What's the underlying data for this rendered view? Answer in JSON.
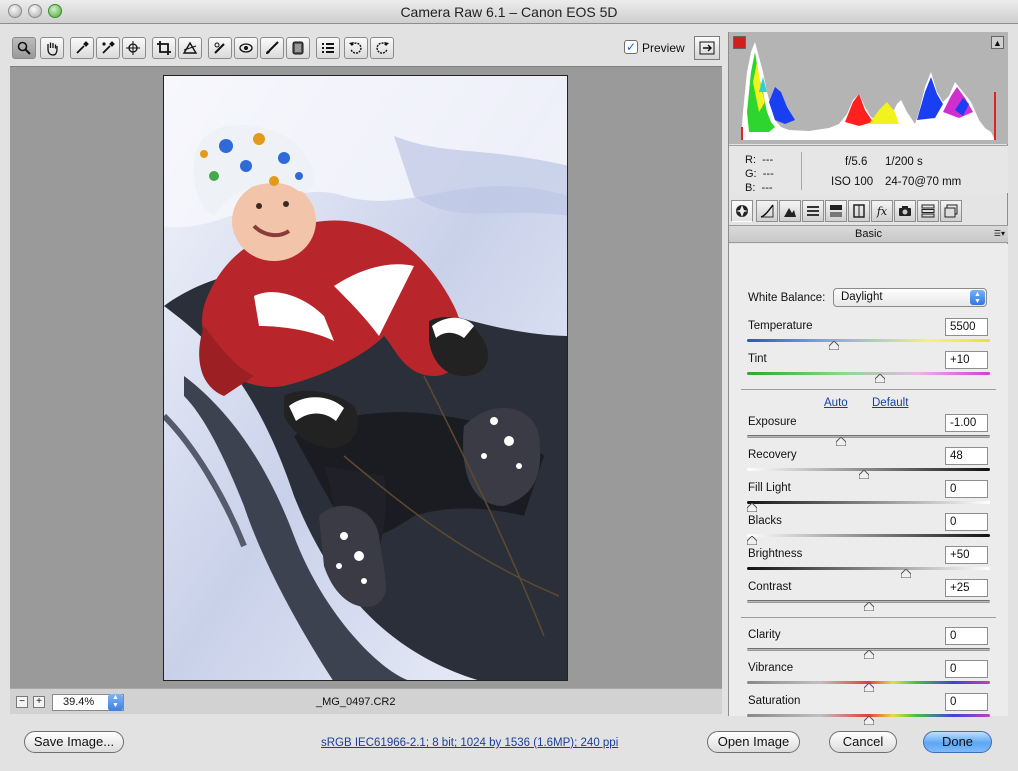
{
  "window": {
    "title": "Camera Raw 6.1  –  Canon EOS 5D"
  },
  "toolbar": {
    "tools": [
      {
        "name": "zoom-tool",
        "icon": "magnifier-icon"
      },
      {
        "name": "hand-tool",
        "icon": "hand-icon"
      },
      {
        "name": "white-balance-tool",
        "icon": "eyedropper-icon"
      },
      {
        "name": "color-sampler-tool",
        "icon": "color-sampler-icon"
      },
      {
        "name": "targeted-adjustment-tool",
        "icon": "target-icon"
      },
      {
        "name": "crop-tool",
        "icon": "crop-icon"
      },
      {
        "name": "straighten-tool",
        "icon": "straighten-icon"
      },
      {
        "name": "spot-removal-tool",
        "icon": "spot-brush-icon"
      },
      {
        "name": "red-eye-tool",
        "icon": "red-eye-icon"
      },
      {
        "name": "adjustment-brush-tool",
        "icon": "brush-icon"
      },
      {
        "name": "graduated-filter-tool",
        "icon": "gradient-icon"
      },
      {
        "name": "preferences-tool",
        "icon": "list-icon"
      },
      {
        "name": "rotate-ccw-tool",
        "icon": "rotate-ccw-icon"
      },
      {
        "name": "rotate-cw-tool",
        "icon": "rotate-cw-icon"
      }
    ],
    "preview_label": "Preview",
    "preview_checked": true
  },
  "status": {
    "zoom": "39.4%",
    "filename": "_MG_0497.CR2"
  },
  "readout": {
    "r_label": "R:",
    "g_label": "G:",
    "b_label": "B:",
    "r_value": "---",
    "g_value": "---",
    "b_value": "---",
    "aperture": "f/5.6",
    "shutter": "1/200 s",
    "iso": "ISO 100",
    "lens": "24-70@70 mm"
  },
  "panel": {
    "tabs": [
      "basic-tab",
      "tone-curve-tab",
      "detail-tab",
      "hsl-tab",
      "split-toning-tab",
      "lens-corrections-tab",
      "effects-tab",
      "camera-calibration-tab",
      "presets-tab",
      "snapshots-tab"
    ],
    "section_title": "Basic",
    "white_balance_label": "White Balance:",
    "white_balance_value": "Daylight",
    "auto_label": "Auto",
    "default_label": "Default",
    "sliders": [
      {
        "key": "temperature",
        "label": "Temperature",
        "value": "5500",
        "position": 0.35
      },
      {
        "key": "tint",
        "label": "Tint",
        "value": "+10",
        "position": 0.55
      },
      {
        "key": "exposure",
        "label": "Exposure",
        "value": "-1.00",
        "position": 0.38
      },
      {
        "key": "recovery",
        "label": "Recovery",
        "value": "48",
        "position": 0.48
      },
      {
        "key": "fill-light",
        "label": "Fill Light",
        "value": "0",
        "position": 0.0
      },
      {
        "key": "blacks",
        "label": "Blacks",
        "value": "0",
        "position": 0.0
      },
      {
        "key": "brightness",
        "label": "Brightness",
        "value": "+50",
        "position": 0.66
      },
      {
        "key": "contrast",
        "label": "Contrast",
        "value": "+25",
        "position": 0.5
      },
      {
        "key": "clarity",
        "label": "Clarity",
        "value": "0",
        "position": 0.5
      },
      {
        "key": "vibrance",
        "label": "Vibrance",
        "value": "0",
        "position": 0.5
      },
      {
        "key": "saturation",
        "label": "Saturation",
        "value": "0",
        "position": 0.5
      }
    ]
  },
  "footer": {
    "save_label": "Save Image...",
    "workflow_info": "sRGB IEC61966-2.1; 8 bit; 1024 by 1536 (1.6MP); 240 ppi",
    "open_label": "Open Image",
    "cancel_label": "Cancel",
    "done_label": "Done"
  },
  "colors": {
    "accent": "#3d7fe0",
    "clip_warning": "#e22222",
    "link": "#1a3f9b"
  }
}
